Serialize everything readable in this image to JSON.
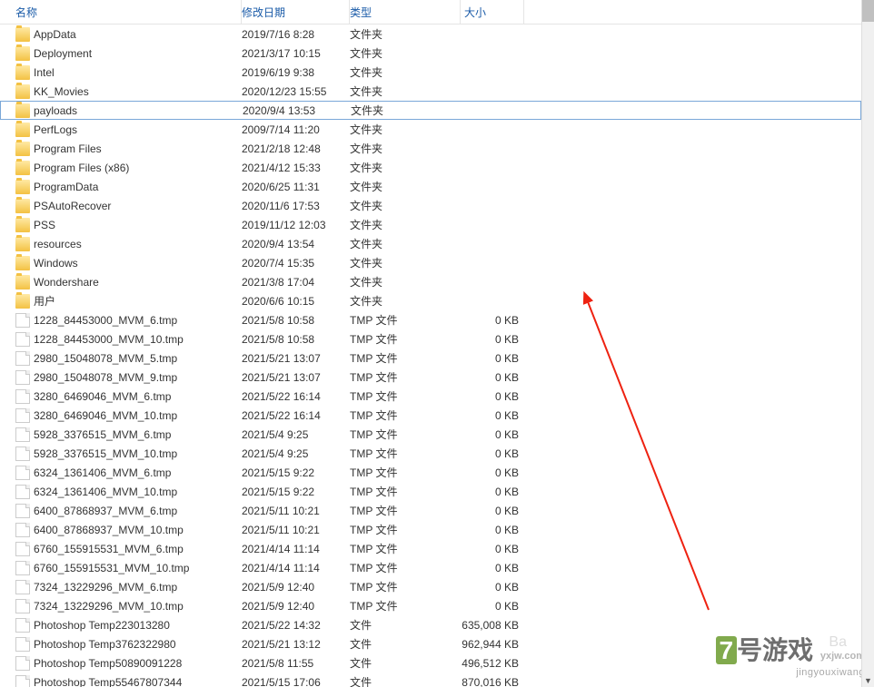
{
  "columns": {
    "name": "名称",
    "date": "修改日期",
    "type": "类型",
    "size": "大小"
  },
  "types": {
    "folder": "文件夹",
    "tmp": "TMP 文件",
    "file": "文件"
  },
  "selected_index": 4,
  "rows": [
    {
      "icon": "folder",
      "name": "AppData",
      "date": "2019/7/16 8:28",
      "type": "文件夹",
      "size": ""
    },
    {
      "icon": "folder",
      "name": "Deployment",
      "date": "2021/3/17 10:15",
      "type": "文件夹",
      "size": ""
    },
    {
      "icon": "folder",
      "name": "Intel",
      "date": "2019/6/19 9:38",
      "type": "文件夹",
      "size": ""
    },
    {
      "icon": "folder",
      "name": "KK_Movies",
      "date": "2020/12/23 15:55",
      "type": "文件夹",
      "size": ""
    },
    {
      "icon": "folder",
      "name": "payloads",
      "date": "2020/9/4 13:53",
      "type": "文件夹",
      "size": ""
    },
    {
      "icon": "folder",
      "name": "PerfLogs",
      "date": "2009/7/14 11:20",
      "type": "文件夹",
      "size": ""
    },
    {
      "icon": "folder",
      "name": "Program Files",
      "date": "2021/2/18 12:48",
      "type": "文件夹",
      "size": ""
    },
    {
      "icon": "folder",
      "name": "Program Files (x86)",
      "date": "2021/4/12 15:33",
      "type": "文件夹",
      "size": ""
    },
    {
      "icon": "folder",
      "name": "ProgramData",
      "date": "2020/6/25 11:31",
      "type": "文件夹",
      "size": ""
    },
    {
      "icon": "folder",
      "name": "PSAutoRecover",
      "date": "2020/11/6 17:53",
      "type": "文件夹",
      "size": ""
    },
    {
      "icon": "folder",
      "name": "PSS",
      "date": "2019/11/12 12:03",
      "type": "文件夹",
      "size": ""
    },
    {
      "icon": "folder",
      "name": "resources",
      "date": "2020/9/4 13:54",
      "type": "文件夹",
      "size": ""
    },
    {
      "icon": "folder",
      "name": "Windows",
      "date": "2020/7/4 15:35",
      "type": "文件夹",
      "size": ""
    },
    {
      "icon": "folder",
      "name": "Wondershare",
      "date": "2021/3/8 17:04",
      "type": "文件夹",
      "size": ""
    },
    {
      "icon": "folder",
      "name": "用户",
      "date": "2020/6/6 10:15",
      "type": "文件夹",
      "size": ""
    },
    {
      "icon": "file",
      "name": "1228_84453000_MVM_6.tmp",
      "date": "2021/5/8 10:58",
      "type": "TMP 文件",
      "size": "0 KB"
    },
    {
      "icon": "file",
      "name": "1228_84453000_MVM_10.tmp",
      "date": "2021/5/8 10:58",
      "type": "TMP 文件",
      "size": "0 KB"
    },
    {
      "icon": "file",
      "name": "2980_15048078_MVM_5.tmp",
      "date": "2021/5/21 13:07",
      "type": "TMP 文件",
      "size": "0 KB"
    },
    {
      "icon": "file",
      "name": "2980_15048078_MVM_9.tmp",
      "date": "2021/5/21 13:07",
      "type": "TMP 文件",
      "size": "0 KB"
    },
    {
      "icon": "file",
      "name": "3280_6469046_MVM_6.tmp",
      "date": "2021/5/22 16:14",
      "type": "TMP 文件",
      "size": "0 KB"
    },
    {
      "icon": "file",
      "name": "3280_6469046_MVM_10.tmp",
      "date": "2021/5/22 16:14",
      "type": "TMP 文件",
      "size": "0 KB"
    },
    {
      "icon": "file",
      "name": "5928_3376515_MVM_6.tmp",
      "date": "2021/5/4 9:25",
      "type": "TMP 文件",
      "size": "0 KB"
    },
    {
      "icon": "file",
      "name": "5928_3376515_MVM_10.tmp",
      "date": "2021/5/4 9:25",
      "type": "TMP 文件",
      "size": "0 KB"
    },
    {
      "icon": "file",
      "name": "6324_1361406_MVM_6.tmp",
      "date": "2021/5/15 9:22",
      "type": "TMP 文件",
      "size": "0 KB"
    },
    {
      "icon": "file",
      "name": "6324_1361406_MVM_10.tmp",
      "date": "2021/5/15 9:22",
      "type": "TMP 文件",
      "size": "0 KB"
    },
    {
      "icon": "file",
      "name": "6400_87868937_MVM_6.tmp",
      "date": "2021/5/11 10:21",
      "type": "TMP 文件",
      "size": "0 KB"
    },
    {
      "icon": "file",
      "name": "6400_87868937_MVM_10.tmp",
      "date": "2021/5/11 10:21",
      "type": "TMP 文件",
      "size": "0 KB"
    },
    {
      "icon": "file",
      "name": "6760_155915531_MVM_6.tmp",
      "date": "2021/4/14 11:14",
      "type": "TMP 文件",
      "size": "0 KB"
    },
    {
      "icon": "file",
      "name": "6760_155915531_MVM_10.tmp",
      "date": "2021/4/14 11:14",
      "type": "TMP 文件",
      "size": "0 KB"
    },
    {
      "icon": "file",
      "name": "7324_13229296_MVM_6.tmp",
      "date": "2021/5/9 12:40",
      "type": "TMP 文件",
      "size": "0 KB"
    },
    {
      "icon": "file",
      "name": "7324_13229296_MVM_10.tmp",
      "date": "2021/5/9 12:40",
      "type": "TMP 文件",
      "size": "0 KB"
    },
    {
      "icon": "file",
      "name": "Photoshop Temp223013280",
      "date": "2021/5/22 14:32",
      "type": "文件",
      "size": "635,008 KB"
    },
    {
      "icon": "file",
      "name": "Photoshop Temp3762322980",
      "date": "2021/5/21 13:12",
      "type": "文件",
      "size": "962,944 KB"
    },
    {
      "icon": "file",
      "name": "Photoshop Temp50890091228",
      "date": "2021/5/8 11:55",
      "type": "文件",
      "size": "496,512 KB"
    },
    {
      "icon": "file",
      "name": "Photoshop Temp55467807344",
      "date": "2021/5/15 17:06",
      "type": "文件",
      "size": "870,016 KB"
    }
  ],
  "watermark": {
    "brand_num": "7",
    "brand_text": "号游戏",
    "domain": "yxjw.com",
    "pinyin": "jingyouxiwang",
    "behind": "Ba"
  }
}
